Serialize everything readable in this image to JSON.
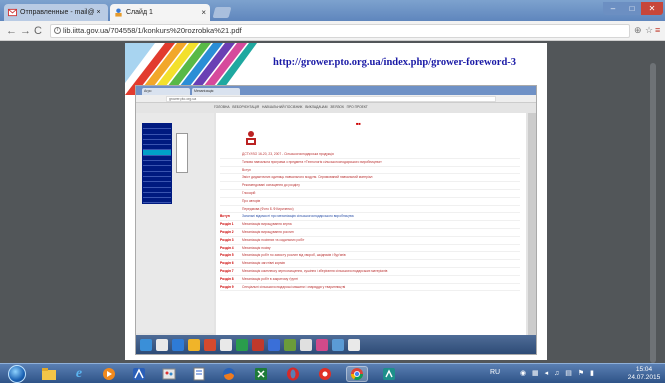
{
  "browser": {
    "tabs": [
      {
        "label": "Отправленные - mail@ ×"
      },
      {
        "label": "Слайд 1"
      }
    ],
    "address": "lib.iitta.gov.ua/704558/1/konkurs%20rozrobka%21.pdf",
    "colors": {
      "tab_bar": "#6f92c6",
      "close": "#c7463a",
      "pdf_background": "#525659"
    }
  },
  "pdf": {
    "header_url": "http://grower.pto.org.ua/index.php/grower-foreword-3"
  },
  "embedded": {
    "menu_items": [
      "ГОЛОВНА",
      "ВЕБОРІЄНТАЦІЯ",
      "НАВЧАЛЬНИЙ ПОСІБНИК",
      "ВИКЛАДАЧАМ",
      "ЗВ'ЯЗОК",
      "ПРО ПРОЕКТ"
    ],
    "content_rows": [
      {
        "key": "",
        "value": "ДСТУ/ISO 16-20, 23, 2007 - Сільськогосподарська продукція",
        "blue": false
      },
      {
        "key": "",
        "value": "Типова навчальна програма з предмета «Технологія сільськогосподарського виробництва»",
        "blue": false
      },
      {
        "key": "",
        "value": "Вступ",
        "blue": false
      },
      {
        "key": "",
        "value": "Зміст дидактичних одиниць навчального модуля. Спрямований навчальний матеріал",
        "blue": false
      },
      {
        "key": "",
        "value": "Рекомендовані оснащення до розділу",
        "blue": false
      },
      {
        "key": "",
        "value": "Глосарій",
        "blue": false
      },
      {
        "key": "",
        "value": "Про авторів",
        "blue": false
      },
      {
        "key": "",
        "value": "Передмова (Фото Б.Ф.Кириченко)",
        "blue": false
      },
      {
        "key": "Вступ",
        "value": "Загальні відомості про механізацію сільськогосподарського виробництва",
        "blue": true
      },
      {
        "key": "Розділ 1",
        "value": "Механізація вирощування зерна",
        "blue": false
      },
      {
        "key": "Розділ 2",
        "value": "Механізація вирощування рослин",
        "blue": false
      },
      {
        "key": "Розділ 3",
        "value": "Механізація посівних та садильних робіт",
        "blue": false
      },
      {
        "key": "Розділ 4",
        "value": "Механізація посіву",
        "blue": false
      },
      {
        "key": "Розділ 5",
        "value": "Механізація робіт по захисту рослин від хвороб, шкідників і бур'янів",
        "blue": false
      },
      {
        "key": "Розділ 6",
        "value": "Механізація заготівлі кормів",
        "blue": false
      },
      {
        "key": "Розділ 7",
        "value": "Механізація комплексу зерноочищення, сушіння і зберігання сільськогосподарських матеріалів",
        "blue": false
      },
      {
        "key": "Розділ 8",
        "value": "Механізація робіт в закритому ґрунті",
        "blue": false
      },
      {
        "key": "Розділ 9",
        "value": "Спеціальні сільськогосподарські машини і знаряддя у тваринництві",
        "blue": false
      }
    ]
  },
  "taskbar": {
    "language": "RU",
    "clock_time": "15:04",
    "clock_date": "24.07.2015"
  }
}
